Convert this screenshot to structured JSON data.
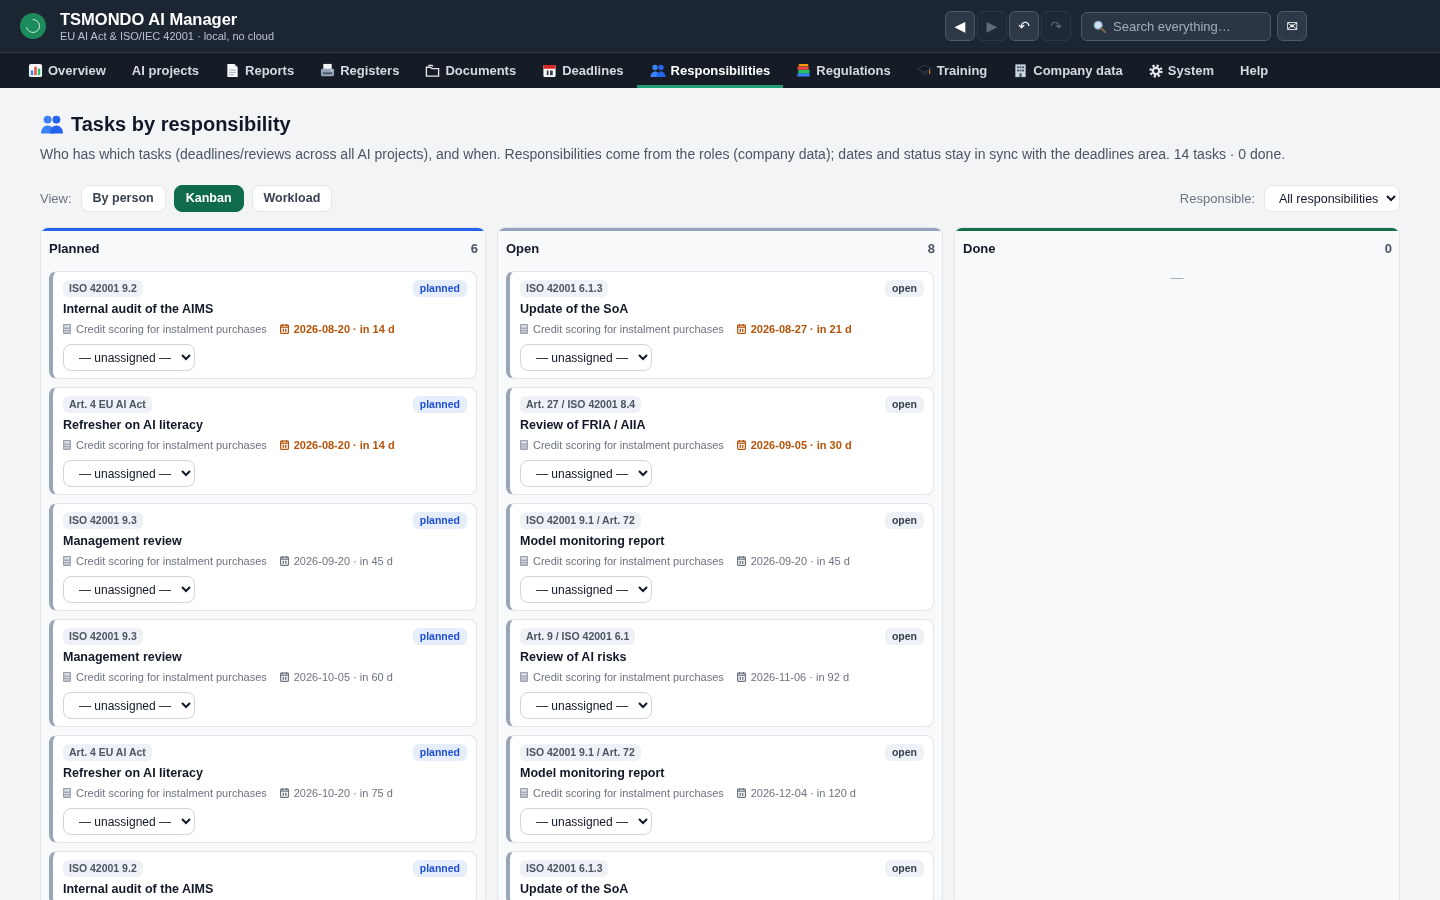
{
  "app": {
    "title": "TSMONDO AI Manager",
    "subtitle": "EU AI Act & ISO/IEC 42001 · local, no cloud"
  },
  "history_buttons": [
    {
      "label": "◀",
      "disabled": false
    },
    {
      "label": "▶",
      "disabled": true
    },
    {
      "label": "↶",
      "disabled": false
    },
    {
      "label": "↷",
      "disabled": true
    }
  ],
  "search": {
    "placeholder": "Search everything…"
  },
  "mail_button": {
    "label": "✉"
  },
  "nav": [
    {
      "label": "Overview",
      "selected": false
    },
    {
      "label": "AI projects",
      "selected": false
    },
    {
      "label": "Reports",
      "selected": false
    },
    {
      "label": "Registers",
      "selected": false
    },
    {
      "label": "Documents",
      "selected": false
    },
    {
      "label": "Deadlines",
      "selected": false
    },
    {
      "label": "Responsibilities",
      "selected": true
    },
    {
      "label": "Regulations",
      "selected": false
    },
    {
      "label": "Training",
      "selected": false
    },
    {
      "label": "Company data",
      "selected": false
    },
    {
      "label": "System",
      "selected": false
    },
    {
      "label": "Help",
      "selected": false
    }
  ],
  "page": {
    "title": "Tasks by responsibility",
    "description": "Who has which tasks (deadlines/reviews across all AI projects), and when. Responsibilities come from the roles (company data); dates and status stay in sync with the deadlines area. 14 tasks · 0 done."
  },
  "view_switch": {
    "label": "View:",
    "options": [
      {
        "label": "By person",
        "selected": false
      },
      {
        "label": "Kanban",
        "selected": true
      },
      {
        "label": "Workload",
        "selected": false
      }
    ]
  },
  "responsible_filter": {
    "label": "Responsible:",
    "value": "All responsibilities"
  },
  "board": {
    "columns": [
      {
        "title": "Planned",
        "count": "6",
        "kind": "planned",
        "color": "#2563eb",
        "cards": [
          {
            "tag": "ISO 42001 9.2",
            "status": "planned",
            "title": "Internal audit of the AIMS",
            "project": "Credit scoring for instalment purchases",
            "due": "2026-08-20 · in 14 d",
            "soon": true,
            "assignee": "— unassigned —"
          },
          {
            "tag": "Art. 4 EU AI Act",
            "status": "planned",
            "title": "Refresher on AI literacy",
            "project": "Credit scoring for instalment purchases",
            "due": "2026-08-20 · in 14 d",
            "soon": true,
            "assignee": "— unassigned —"
          },
          {
            "tag": "ISO 42001 9.3",
            "status": "planned",
            "title": "Management review",
            "project": "Credit scoring for instalment purchases",
            "due": "2026-09-20 · in 45 d",
            "soon": false,
            "assignee": "— unassigned —"
          },
          {
            "tag": "ISO 42001 9.3",
            "status": "planned",
            "title": "Management review",
            "project": "Credit scoring for instalment purchases",
            "due": "2026-10-05 · in 60 d",
            "soon": false,
            "assignee": "— unassigned —"
          },
          {
            "tag": "Art. 4 EU AI Act",
            "status": "planned",
            "title": "Refresher on AI literacy",
            "project": "Credit scoring for instalment purchases",
            "due": "2026-10-20 · in 75 d",
            "soon": false,
            "assignee": "— unassigned —"
          },
          {
            "tag": "ISO 42001 9.2",
            "status": "planned",
            "title": "Internal audit of the AIMS"
          }
        ]
      },
      {
        "title": "Open",
        "count": "8",
        "kind": "open",
        "color": "#94a3b8",
        "cards": [
          {
            "tag": "ISO 42001 6.1.3",
            "status": "open",
            "title": "Update of the SoA",
            "project": "Credit scoring for instalment purchases",
            "due": "2026-08-27 · in 21 d",
            "soon": true,
            "assignee": "— unassigned —"
          },
          {
            "tag": "Art. 27 / ISO 42001 8.4",
            "status": "open",
            "title": "Review of FRIA / AIIA",
            "project": "Credit scoring for instalment purchases",
            "due": "2026-09-05 · in 30 d",
            "soon": true,
            "assignee": "— unassigned —"
          },
          {
            "tag": "ISO 42001 9.1 / Art. 72",
            "status": "open",
            "title": "Model monitoring report",
            "project": "Credit scoring for instalment purchases",
            "due": "2026-09-20 · in 45 d",
            "soon": false,
            "assignee": "— unassigned —"
          },
          {
            "tag": "Art. 9 / ISO 42001 6.1",
            "status": "open",
            "title": "Review of AI risks",
            "project": "Credit scoring for instalment purchases",
            "due": "2026-11-06 · in 92 d",
            "soon": false,
            "assignee": "— unassigned —"
          },
          {
            "tag": "ISO 42001 9.1 / Art. 72",
            "status": "open",
            "title": "Model monitoring report",
            "project": "Credit scoring for instalment purchases",
            "due": "2026-12-04 · in 120 d",
            "soon": false,
            "assignee": "— unassigned —"
          },
          {
            "tag": "ISO 42001 6.1.3",
            "status": "open",
            "title": "Update of the SoA"
          }
        ]
      },
      {
        "title": "Done",
        "count": "0",
        "color": "#166b4a",
        "empty_text": "—"
      }
    ]
  }
}
